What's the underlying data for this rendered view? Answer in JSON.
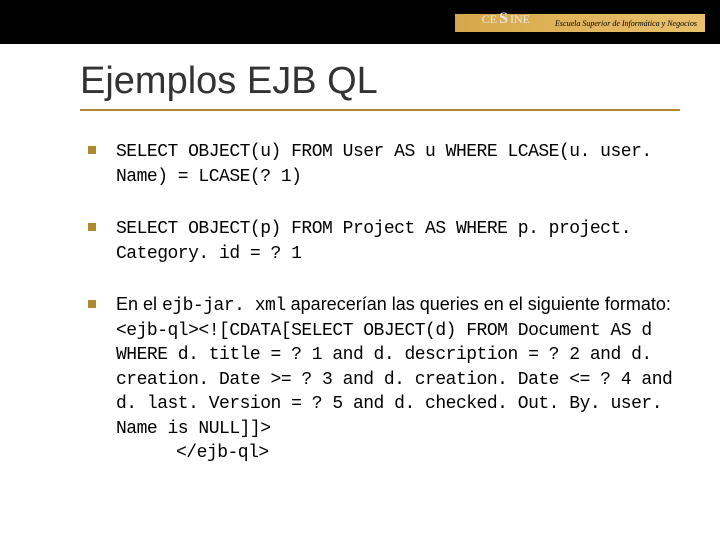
{
  "header": {
    "logo_text_left": "CE",
    "logo_text_big": "S",
    "logo_text_right": "INE",
    "stripe_text": "Escuela Superior de Informática y Negocios"
  },
  "title": "Ejemplos EJB QL",
  "bullets": [
    {
      "text": "SELECT OBJECT(u) FROM User AS u WHERE LCASE(u. user. Name) = LCASE(? 1)"
    },
    {
      "text": "SELECT OBJECT(p) FROM Project AS WHERE p. project. Category. id = ? 1"
    },
    {
      "intro_sans_1": "En el ",
      "intro_mono": "ejb-jar. xml",
      "intro_sans_2": " aparecerían las queries en el siguiente formato:",
      "code": "<ejb-ql><![CDATA[SELECT OBJECT(d) FROM Document AS d WHERE d. title = ? 1 and d. description = ? 2 and d. creation. Date >= ? 3 and d. creation. Date <= ? 4 and d. last. Version = ? 5 and d. checked. Out. By. user. Name is NULL]]>",
      "code_close": "</ejb-ql>"
    }
  ]
}
